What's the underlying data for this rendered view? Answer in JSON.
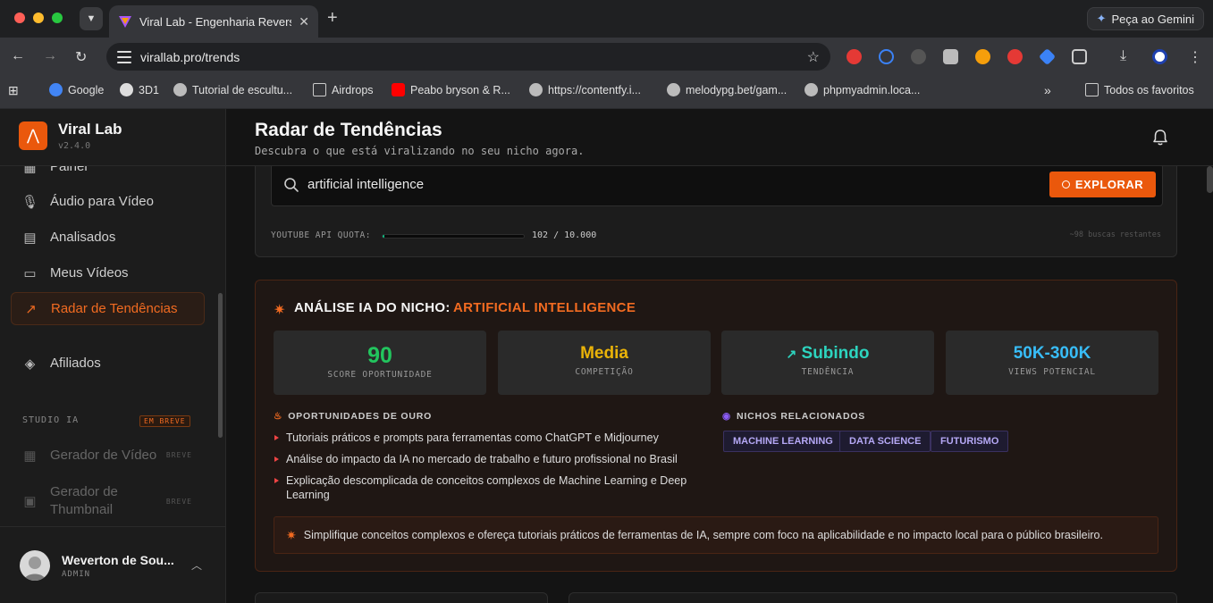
{
  "browser": {
    "tab_title": "Viral Lab - Engenharia Reversa",
    "gemini_label": "Peça ao Gemini",
    "url": "virallab.pro/trends",
    "bookmarks": [
      {
        "label": "Google",
        "icon": "google-icon",
        "color": "#4285f4"
      },
      {
        "label": "3D1",
        "icon": "3d1-icon",
        "color": "#dddddd"
      },
      {
        "label": "Tutorial de escultu...",
        "icon": "wordpress-icon",
        "color": "#bbbbbb"
      },
      {
        "label": "Airdrops",
        "icon": "folder-icon",
        "color": "#cccccc"
      },
      {
        "label": "Peabo bryson & R...",
        "icon": "youtube-icon",
        "color": "#ff0000"
      },
      {
        "label": "https://contentfy.i...",
        "icon": "globe-icon",
        "color": "#bbbbbb"
      },
      {
        "label": "melodypg.bet/gam...",
        "icon": "globe-icon",
        "color": "#bbbbbb"
      },
      {
        "label": "phpmyadmin.loca...",
        "icon": "globe-icon",
        "color": "#bbbbbb"
      }
    ],
    "all_bookmarks": "Todos os favoritos"
  },
  "app": {
    "name": "Viral Lab",
    "version": "v2.4.0",
    "nav": [
      {
        "label": "Painel",
        "icon": "dashboard-icon"
      },
      {
        "label": "Áudio para Vídeo",
        "icon": "microphone-icon"
      },
      {
        "label": "Analisados",
        "icon": "document-icon"
      },
      {
        "label": "Meus Vídeos",
        "icon": "video-icon"
      },
      {
        "label": "Radar de Tendências",
        "icon": "trending-up-icon",
        "active": true
      },
      {
        "label": "Afiliados",
        "icon": "tag-icon"
      }
    ],
    "studio_label": "STUDIO IA",
    "studio_badge": "EM BREVE",
    "studio_items": [
      {
        "label": "Gerador de Vídeo",
        "badge": "BREVE",
        "icon": "film-icon"
      },
      {
        "label": "Gerador de Thumbnail",
        "badge": "BREVE",
        "icon": "image-icon"
      }
    ],
    "user": {
      "name": "Weverton de Sou...",
      "role": "ADMIN"
    }
  },
  "page": {
    "title": "Radar de Tendências",
    "subtitle": "Descubra o que está viralizando no seu nicho agora."
  },
  "search": {
    "value": "artificial intelligence",
    "button": "EXPLORAR",
    "quota_label": "YOUTUBE API QUOTA:",
    "quota_value": "102 / 10.000",
    "quota_fraction": 0.0102,
    "quota_remaining": "~98 buscas restantes"
  },
  "analysis": {
    "title": "ANÁLISE IA DO NICHO:",
    "niche": "ARTIFICIAL INTELLIGENCE",
    "metrics": [
      {
        "value": "90",
        "label": "SCORE OPORTUNIDADE",
        "color": "#22c55e"
      },
      {
        "value": "Media",
        "label": "COMPETIÇÃO",
        "color": "#eab308"
      },
      {
        "value": "Subindo",
        "label": "TENDÊNCIA",
        "color": "#2dd4bf"
      },
      {
        "value": "50K-300K",
        "label": "VIEWS POTENCIAL",
        "color": "#38bdf8"
      }
    ],
    "opportunities_title": "OPORTUNIDADES DE OURO",
    "opportunities": [
      "Tutoriais práticos e prompts para ferramentas como ChatGPT e Midjourney",
      "Análise do impacto da IA no mercado de trabalho e futuro profissional no Brasil",
      "Explicação descomplicada de conceitos complexos de Machine Learning e Deep Learning"
    ],
    "related_title": "NICHOS RELACIONADOS",
    "related": [
      "MACHINE LEARNING",
      "DATA SCIENCE",
      "FUTURISMO"
    ],
    "tip": "Simplifique conceitos complexos e ofereça tutoriais práticos de ferramentas de IA, sempre com foco na aplicabilidade e no impacto local para o público brasileiro."
  }
}
